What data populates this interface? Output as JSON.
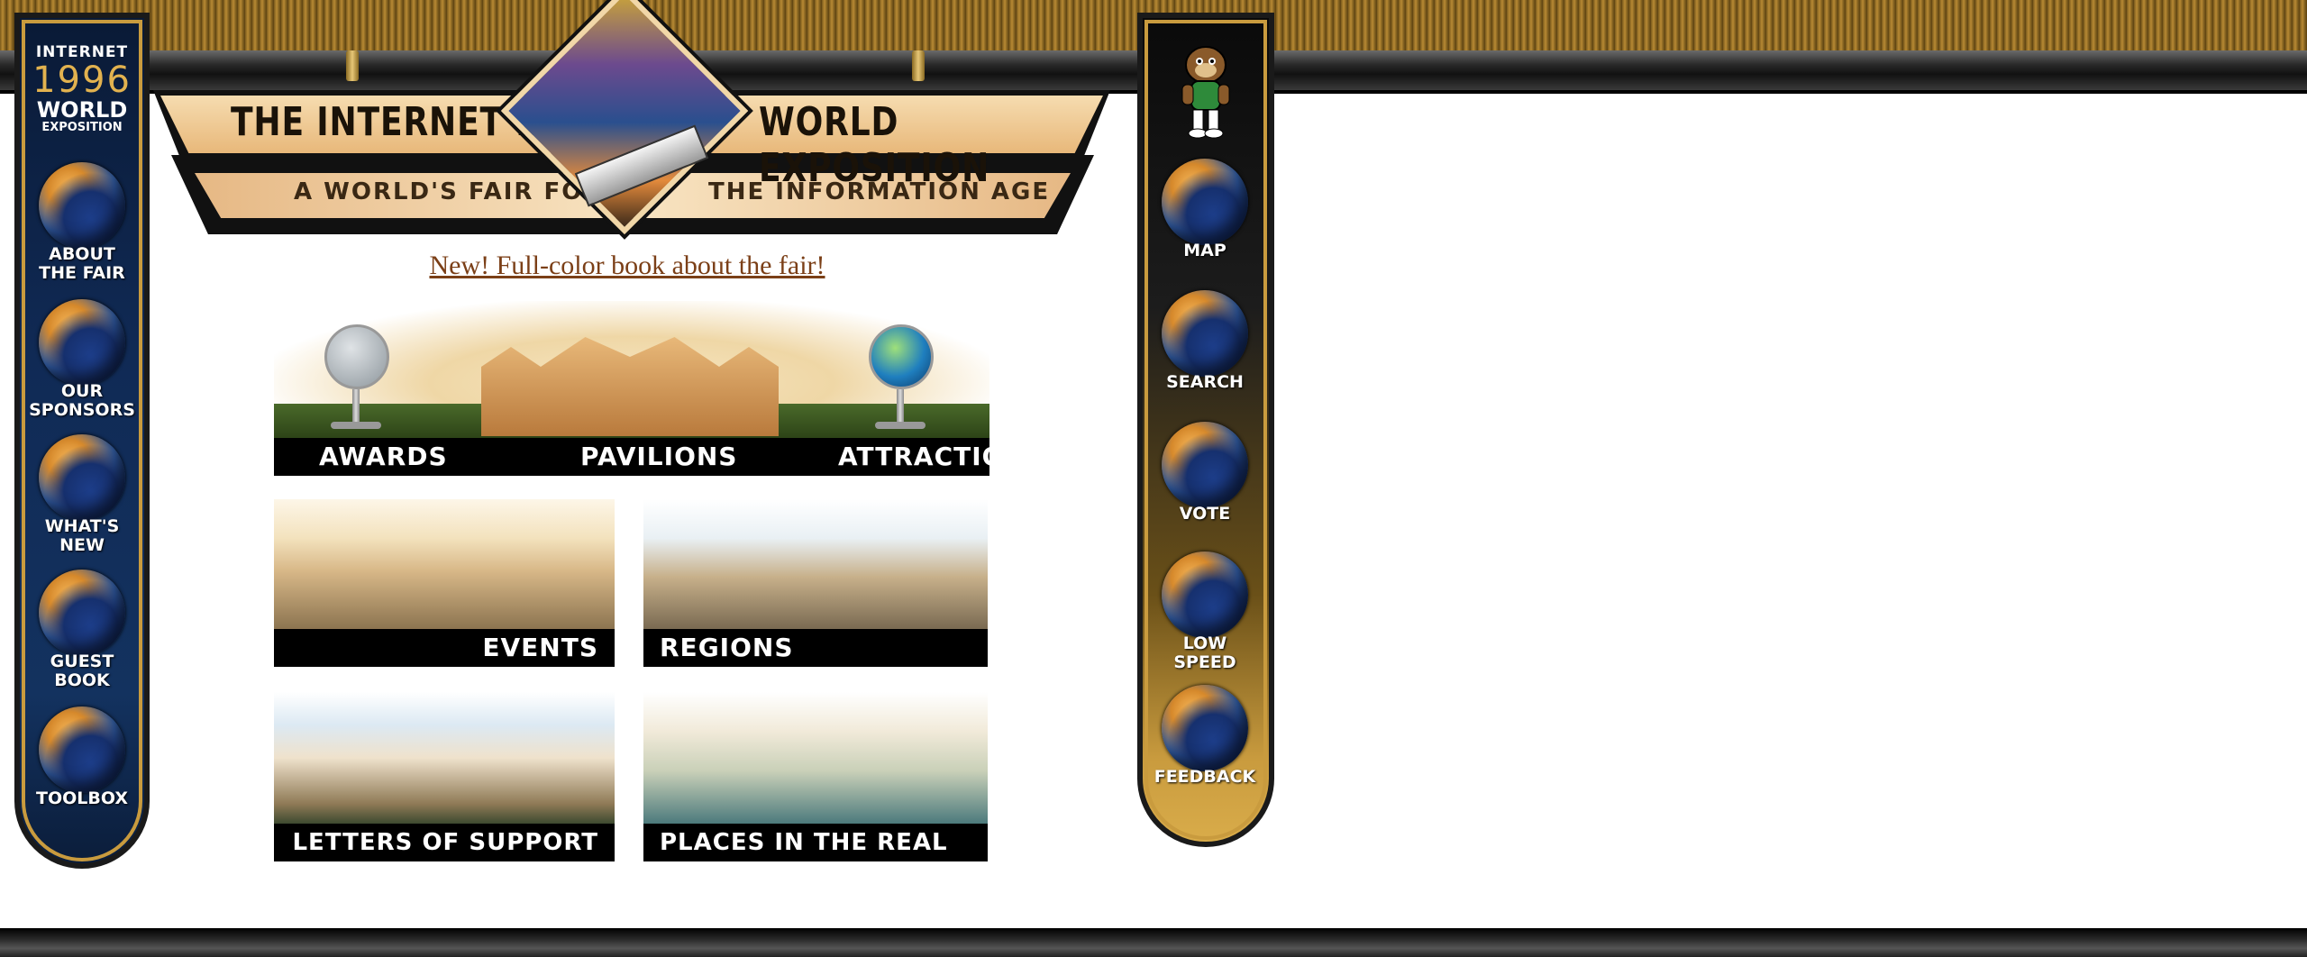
{
  "left_nav": {
    "logo": {
      "line1": "INTERNET",
      "line2": "1996",
      "line3": "WORLD",
      "line4": "EXPOSITION"
    },
    "items": [
      {
        "label": "ABOUT\nTHE FAIR"
      },
      {
        "label": "OUR\nSPONSORS"
      },
      {
        "label": "WHAT'S\nNEW"
      },
      {
        "label": "GUEST\nBOOK"
      },
      {
        "label": "TOOLBOX"
      }
    ]
  },
  "right_nav": {
    "items": [
      {
        "label": "MAP"
      },
      {
        "label": "SEARCH"
      },
      {
        "label": "VOTE"
      },
      {
        "label": "LOW\nSPEED"
      },
      {
        "label": "FEEDBACK"
      }
    ]
  },
  "banner": {
    "title_left": "THE INTERNET 1996",
    "title_right": "WORLD EXPOSITION",
    "subtitle_left": "A WORLD'S FAIR FOR",
    "subtitle_right": "THE INFORMATION AGE"
  },
  "book_link": "New! Full-color book about the fair!",
  "tiles": {
    "awards": "AWARDS",
    "pavilions": "PAVILIONS",
    "attractions": "ATTRACTIONS",
    "events": "EVENTS",
    "regions": "REGIONS",
    "letters": "LETTERS OF SUPPORT",
    "places": "PLACES IN THE REAL WORLD"
  },
  "colors": {
    "link": "#7b3f17",
    "gold": "#c99b3e",
    "navy": "#102a55"
  }
}
